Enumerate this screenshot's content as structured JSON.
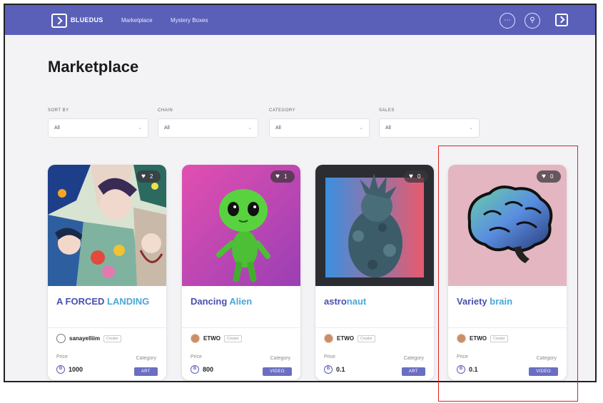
{
  "header": {
    "logo_text": "BLUEDUS",
    "nav": [
      "Marketplace",
      "Mystery Boxes"
    ]
  },
  "page": {
    "title": "Marketplace"
  },
  "filters": [
    {
      "label": "Sort by",
      "value": "All"
    },
    {
      "label": "Chain",
      "value": "All"
    },
    {
      "label": "Category",
      "value": "All"
    },
    {
      "label": "Sales",
      "value": "All"
    }
  ],
  "cards": [
    {
      "title_part1": "A FORCED ",
      "title_part2": "LANDING",
      "likes": "2",
      "owner": "sanayelliim",
      "owner_tag": "Creator",
      "price_label": "Price",
      "price": "1000",
      "category_label": "Category",
      "category": "ART"
    },
    {
      "title_part1": "Dancing ",
      "title_part2": "Alien",
      "likes": "1",
      "owner": "ETWO",
      "owner_tag": "Creator",
      "price_label": "Price",
      "price": "800",
      "category_label": "Category",
      "category": "VIDEO"
    },
    {
      "title_part1": "astro",
      "title_part2": "naut",
      "likes": "0",
      "owner": "ETWO",
      "owner_tag": "Creator",
      "price_label": "Price",
      "price": "0.1",
      "category_label": "Category",
      "category": "ART"
    },
    {
      "title_part1": "Variety ",
      "title_part2": "brain",
      "likes": "0",
      "owner": "ETWO",
      "owner_tag": "Creator",
      "price_label": "Price",
      "price": "0.1",
      "category_label": "Category",
      "category": "VIDEO"
    }
  ],
  "colors": {
    "header": "#5a5fb8",
    "title_primary": "#4a4fae",
    "title_accent": "#4aa6d8",
    "highlight": "#e02020"
  }
}
